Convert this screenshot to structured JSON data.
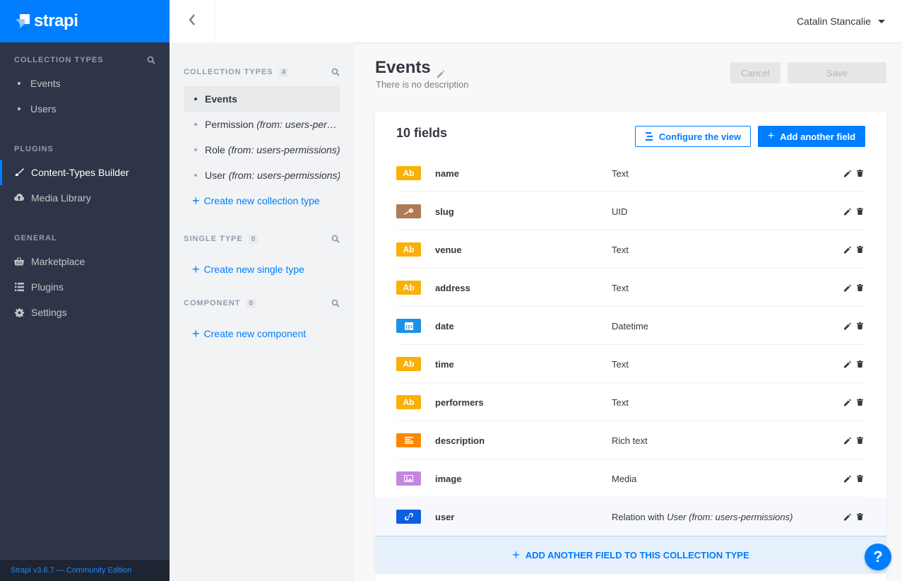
{
  "brand": {
    "name": "strapi"
  },
  "leftnav": {
    "sections": [
      {
        "title": "COLLECTION TYPES",
        "items": [
          "Events",
          "Users"
        ]
      },
      {
        "title": "PLUGINS",
        "items": [
          "Content-Types Builder",
          "Media Library"
        ]
      },
      {
        "title": "GENERAL",
        "items": [
          "Marketplace",
          "Plugins",
          "Settings"
        ]
      }
    ],
    "footer": "Strapi v3.6.7 — Community Edition"
  },
  "header": {
    "user_name": "Catalin Stancalie"
  },
  "subnav": {
    "collection_types": {
      "title": "COLLECTION TYPES",
      "count": "4",
      "items": [
        {
          "name": "Events",
          "from": ""
        },
        {
          "name": "Permission",
          "from": "(from: users-permiss…"
        },
        {
          "name": "Role",
          "from": "(from: users-permissions)"
        },
        {
          "name": "User",
          "from": "(from: users-permissions)"
        }
      ],
      "create_label": "Create new collection type"
    },
    "single_type": {
      "title": "SINGLE TYPE",
      "count": "0",
      "create_label": "Create new single type"
    },
    "component": {
      "title": "COMPONENT",
      "count": "0",
      "create_label": "Create new component"
    }
  },
  "main": {
    "title": "Events",
    "description": "There is no description",
    "cancel_label": "Cancel",
    "save_label": "Save",
    "fields_count_label": "10 fields",
    "configure_label": "Configure the view",
    "add_field_label": "Add another field",
    "add_bar_label": "ADD ANOTHER FIELD TO THIS COLLECTION TYPE",
    "fields": [
      {
        "name": "name",
        "type": "Text",
        "badge": "Ab",
        "badge_color": "#fab005",
        "icon": "text-icon"
      },
      {
        "name": "slug",
        "type": "UID",
        "badge": "",
        "badge_color": "#ad7b55",
        "icon": "key-icon"
      },
      {
        "name": "venue",
        "type": "Text",
        "badge": "Ab",
        "badge_color": "#fab005",
        "icon": "text-icon"
      },
      {
        "name": "address",
        "type": "Text",
        "badge": "Ab",
        "badge_color": "#fab005",
        "icon": "text-icon"
      },
      {
        "name": "date",
        "type": "Datetime",
        "badge": "",
        "badge_color": "#1c91e7",
        "icon": "calendar-icon"
      },
      {
        "name": "time",
        "type": "Text",
        "badge": "Ab",
        "badge_color": "#fab005",
        "icon": "text-icon"
      },
      {
        "name": "performers",
        "type": "Text",
        "badge": "Ab",
        "badge_color": "#fab005",
        "icon": "text-icon"
      },
      {
        "name": "description",
        "type": "Rich text",
        "badge": "",
        "badge_color": "#fa8805",
        "icon": "richtext-icon"
      },
      {
        "name": "image",
        "type": "Media",
        "badge": "",
        "badge_color": "#c586e0",
        "icon": "image-icon"
      },
      {
        "name": "user",
        "type": "Relation with",
        "type_extra": "User (from: users-permissions)",
        "badge": "",
        "badge_color": "#0e5fe0",
        "icon": "link-icon"
      }
    ]
  },
  "help": {
    "label": "?"
  },
  "colors": {
    "accent": "#007eff",
    "nav_bg": "#2e3548"
  }
}
